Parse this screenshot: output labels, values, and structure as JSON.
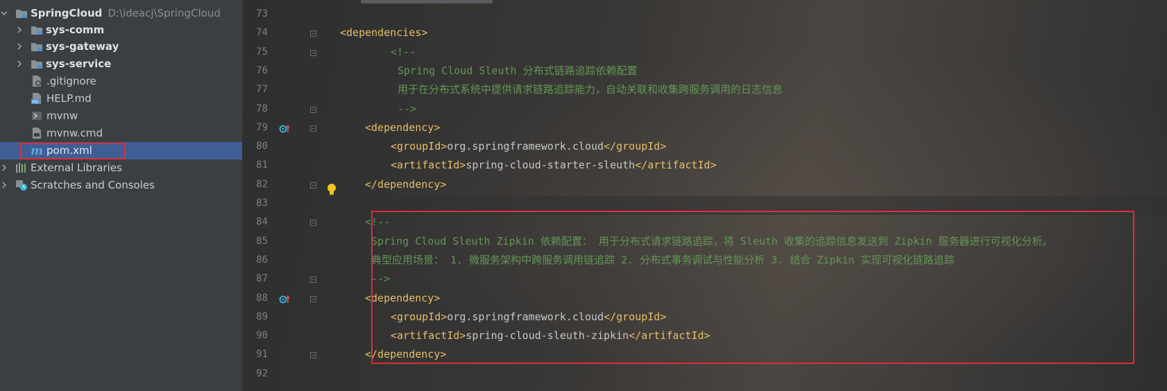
{
  "project": {
    "root_name": "SpringCloud",
    "root_path": "D:\\ideacj\\SpringCloud",
    "folders": [
      "sys-comm",
      "sys-gateway",
      "sys-service"
    ],
    "files": [
      ".gitignore",
      "HELP.md",
      "mvnw",
      "mvnw.cmd",
      "pom.xml"
    ],
    "selected_file": "pom.xml",
    "external_libraries": "External Libraries",
    "scratches": "Scratches and Consoles"
  },
  "editor": {
    "lines": [
      {
        "n": "73",
        "parts": []
      },
      {
        "n": "74",
        "parts": [
          {
            "t": "<dependencies>",
            "c": "tag"
          }
        ]
      },
      {
        "n": "75",
        "parts": [
          {
            "t": "<!--",
            "c": "comment"
          }
        ]
      },
      {
        "n": "76",
        "parts": [
          {
            "t": "Spring Cloud Sleuth 分布式链路追踪依赖配置",
            "c": "comment"
          }
        ]
      },
      {
        "n": "77",
        "parts": [
          {
            "t": "用于在分布式系统中提供请求链路追踪能力，自动关联和收集跨服务调用的日志信息",
            "c": "comment"
          }
        ]
      },
      {
        "n": "78",
        "parts": [
          {
            "t": "-->",
            "c": "comment"
          }
        ]
      },
      {
        "n": "79",
        "parts": [
          {
            "t": "<dependency>",
            "c": "tag"
          }
        ]
      },
      {
        "n": "80",
        "parts": [
          {
            "t": "<groupId>",
            "c": "tag"
          },
          {
            "t": "org.springframework.cloud",
            "c": "text"
          },
          {
            "t": "</groupId>",
            "c": "tag"
          }
        ]
      },
      {
        "n": "81",
        "parts": [
          {
            "t": "<artifactId>",
            "c": "tag"
          },
          {
            "t": "spring-cloud-starter-sleuth",
            "c": "text"
          },
          {
            "t": "</artifactId>",
            "c": "tag"
          }
        ]
      },
      {
        "n": "82",
        "parts": [
          {
            "t": "</dependency>",
            "c": "tag"
          }
        ]
      },
      {
        "n": "83",
        "parts": []
      },
      {
        "n": "84",
        "parts": [
          {
            "t": "<!--",
            "c": "comment"
          }
        ]
      },
      {
        "n": "85",
        "parts": [
          {
            "t": "Spring Cloud Sleuth Zipkin 依赖配置： 用于分布式请求链路追踪，将 Sleuth 收集的追踪信息发送到 Zipkin 服务器进行可视化分析。",
            "c": "comment"
          }
        ]
      },
      {
        "n": "86",
        "parts": [
          {
            "t": "典型应用场景： 1. 微服务架构中跨服务调用链追踪 2. 分布式事务调试与性能分析 3. 结合 Zipkin 实现可视化链路追踪",
            "c": "comment"
          }
        ]
      },
      {
        "n": "87",
        "parts": [
          {
            "t": "-->",
            "c": "comment"
          }
        ]
      },
      {
        "n": "88",
        "parts": [
          {
            "t": "<dependency>",
            "c": "tag"
          }
        ]
      },
      {
        "n": "89",
        "parts": [
          {
            "t": "<groupId>",
            "c": "tag"
          },
          {
            "t": "org.springframework.cloud",
            "c": "text"
          },
          {
            "t": "</groupId>",
            "c": "tag"
          }
        ]
      },
      {
        "n": "90",
        "parts": [
          {
            "t": "<artifactId>",
            "c": "tag"
          },
          {
            "t": "spring-cloud-sleuth-zipkin",
            "c": "text"
          },
          {
            "t": "</artifactId>",
            "c": "tag"
          }
        ]
      },
      {
        "n": "91",
        "parts": [
          {
            "t": "</dependency>",
            "c": "tag"
          }
        ]
      },
      {
        "n": "92",
        "parts": []
      }
    ]
  },
  "colors": {
    "tag": "#e8bf6a",
    "text": "#c8c8c8",
    "comment": "#629755",
    "highlight_box": "#d9303a",
    "selection": "#3f5e95"
  }
}
